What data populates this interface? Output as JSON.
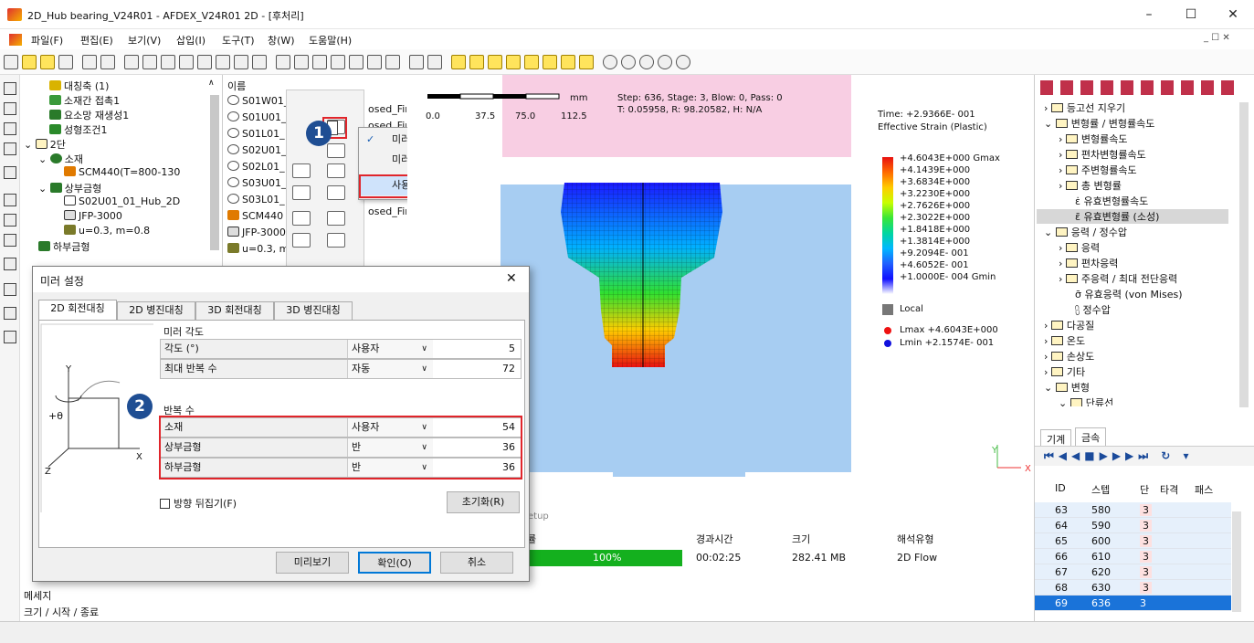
{
  "window": {
    "title": "2D_Hub bearing_V24R01 - AFDEX_V24R01 2D - [후처리]",
    "min": "–",
    "max": "☐",
    "close": "✕"
  },
  "menu": [
    "파일(F)",
    "편집(E)",
    "보기(V)",
    "삽입(I)",
    "도구(T)",
    "창(W)",
    "도움말(H)"
  ],
  "mdi_controls": "_ ☐ ✕",
  "tree": {
    "items": [
      "대칭축 (1)",
      "소재간 접촉1",
      "요소망 재생성1",
      "성형조건1",
      "2단",
      "소재",
      "SCM440(T=800-130",
      "상부금형",
      "S02U01_01_Hub_2D",
      "JFP-3000",
      "u=0.3, m=0.8",
      "하부금형"
    ]
  },
  "namelist": {
    "header": "이름",
    "items": [
      "S01W01_",
      "S01U01_",
      "S01L01_",
      "S02U01_",
      "S02L01_",
      "S03U01_",
      "S03L01_",
      "SCM440",
      "JFP-3000",
      "u=0.3, m"
    ],
    "suffixes": [
      "osed_Fina",
      "osed_Final",
      "",
      "",
      "",
      "",
      "osed_Final",
      "",
      "",
      ""
    ]
  },
  "context_menu": {
    "items": [
      "미러: 켜기",
      "미러: 끄기",
      "사용자 정의..."
    ],
    "check": "✓"
  },
  "callouts": {
    "one": "1",
    "two": "2"
  },
  "viewport": {
    "scale_unit": "mm",
    "scale_ticks": [
      "0.0",
      "37.5",
      "75.0",
      "112.5"
    ],
    "step_line1": "Step: 636, Stage: 3, Blow: 0, Pass: 0",
    "step_line2": "T: 0.05958, R: 98.20582, H: N/A",
    "time": "Time: +2.9366E- 001",
    "measure": "Effective Strain (Plastic)",
    "axis_y": "Y",
    "axis_x": "X"
  },
  "legend": {
    "values": [
      "+4.6043E+000 Gmax",
      "+4.1439E+000",
      "+3.6834E+000",
      "+3.2230E+000",
      "+2.7626E+000",
      "+2.3022E+000",
      "+1.8418E+000",
      "+1.3814E+000",
      "+9.2094E- 001",
      "+4.6052E- 001",
      "+1.0000E- 004 Gmin"
    ],
    "local": "Local",
    "lmax": "Lmax +4.6043E+000",
    "lmin": "Lmin  +2.1574E- 001",
    "lmax_color": "#e11",
    "lmin_color": "#11d"
  },
  "right_tree": [
    "등고선 지우기",
    "변형률 / 변형률속도",
    "변형률속도",
    "편차변형률속도",
    "주변형률속도",
    "총 변형률",
    "유효변형률속도",
    "유효변형률 (소성)",
    "응력 / 정수압",
    "응력",
    "편차응력",
    "주응력 / 최대 전단응력",
    "유효응력 (von Mises)",
    "정수압",
    "다공질",
    "온도",
    "손상도",
    "기타",
    "변형",
    "단류선"
  ],
  "right_tabs": [
    "기계",
    "금속"
  ],
  "grid": {
    "headers": [
      "ID",
      "스텝",
      "단",
      "타격",
      "패스"
    ],
    "rows": [
      [
        "63",
        "580",
        "3"
      ],
      [
        "64",
        "590",
        "3"
      ],
      [
        "65",
        "600",
        "3"
      ],
      [
        "66",
        "610",
        "3"
      ],
      [
        "67",
        "620",
        "3"
      ],
      [
        "68",
        "630",
        "3"
      ],
      [
        "69",
        "636",
        "3"
      ]
    ]
  },
  "jobs": {
    "setup": "etup",
    "progress_header": "률",
    "elapsed_header": "경과시간",
    "size_header": "크기",
    "type_header": "해석유형",
    "progress": "100%",
    "progress_value": 1.0,
    "elapsed": "00:02:25",
    "size": "282.41 MB",
    "type": "2D Flow"
  },
  "bottom": {
    "message": "메세지",
    "sizeinfo": "크기 / 시작 / 종료"
  },
  "dialog": {
    "title": "미러 설정",
    "close": "✕",
    "tabs": [
      "2D 회전대칭",
      "2D 병진대칭",
      "3D 회전대칭",
      "3D 병진대칭"
    ],
    "section1": "미러 각도",
    "section2": "반복 수",
    "angle_label": "각도 (°)",
    "angle_mode": "사용자",
    "angle_value": "5",
    "maxrep_label": "최대 반복 수",
    "maxrep_mode": "자동",
    "maxrep_value": "72",
    "rows": [
      {
        "label": "소재",
        "mode": "사용자",
        "value": "54"
      },
      {
        "label": "상부금형",
        "mode": "반",
        "value": "36"
      },
      {
        "label": "하부금형",
        "mode": "반",
        "value": "36"
      }
    ],
    "flip": "방향 뒤집기(F)",
    "reset": "초기화(R)",
    "preview": "미리보기",
    "ok": "확인(O)",
    "cancel": "취소",
    "axis_y": "Y",
    "axis_x": "X",
    "axis_z": "Z",
    "theta": "+θ"
  }
}
